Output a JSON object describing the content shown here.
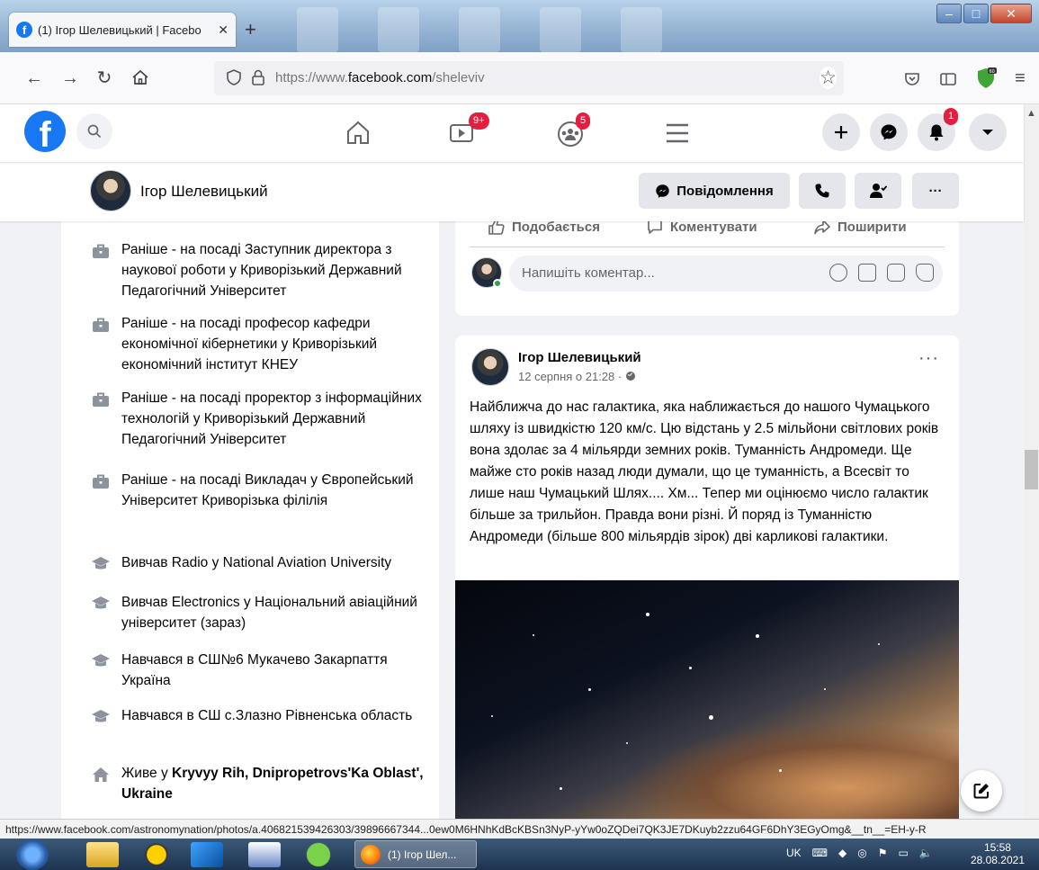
{
  "browser": {
    "tab_title": "(1) Ігор Шелевицький | Facebo",
    "tab_close": "✕",
    "new_tab": "+",
    "url_prefix": "https://www.",
    "url_domain": "facebook.com",
    "url_path": "/sheleviv"
  },
  "fb_nav": {
    "watch_badge": "9+",
    "groups_badge": "5",
    "notifications_badge": "1"
  },
  "profile": {
    "name": "Ігор Шелевицький",
    "message_button": "Повідомлення",
    "more_label": "···"
  },
  "intro": {
    "items": [
      {
        "icon": "briefcase-icon",
        "text": "Раніше - на посаді Заступник директора з наукової роботи у Криворізький Державний Педагогічний Університет"
      },
      {
        "icon": "briefcase-icon",
        "text": "Раніше - на посаді професор кафедри економічної кібернетики у Криворізький економічний інститут КНЕУ"
      },
      {
        "icon": "briefcase-icon",
        "text": "Раніше - на посаді проректор з інформаційних технологій у Криворізький Державний Педагогічний Університет"
      },
      {
        "icon": "briefcase-icon",
        "text": "Раніше - на посаді Викладач у Європейський Університет Криворізька філілія"
      },
      {
        "icon": "graduation-cap-icon",
        "text": "Вивчав Radio у National Aviation University"
      },
      {
        "icon": "graduation-cap-icon",
        "text": "Вивчав Electronics у Національний авіаційний університет (зараз)"
      },
      {
        "icon": "graduation-cap-icon",
        "text": "Навчався в СШ№6 Мукачево Закарпаття Україна"
      },
      {
        "icon": "graduation-cap-icon",
        "text": "Навчався в СШ с.Злазно Рівненська область"
      }
    ],
    "lives_prefix": "Живе у ",
    "lives_place": "Kryvyy Rih, Dnipropetrovs'Ka Oblast', Ukraine"
  },
  "post_actions": {
    "like": "Подобається",
    "comment": "Коментувати",
    "share": "Поширити",
    "comment_placeholder": "Напишіть коментар..."
  },
  "post": {
    "author": "Ігор Шелевицький",
    "date": "12 серпня о 21:28 ·",
    "more": "···",
    "text": "Найближча до нас галактика, яка наближається до нашого Чумацького шляху із швидкістю 120 км/с. Цю відстань у 2.5 мільйони світлових років вона здолає за 4 мільярди земних років. Туманність Андромеди. Ще майже сто років назад люди думали, що це туманність, а Всесвіт то лише наш Чумацький Шлях.... Хм... Тепер ми оцінюємо число галактик більше за трильйон. Правда вони різні. Й поряд із Туманністю Андромеди (більше 800 мільярдів зірок) дві карликові галактики."
  },
  "status_bar": {
    "link": "https://www.facebook.com/astronomynation/photos/a.406821539426303/39896667344...0ew0M6HNhKdBcKBSn3NyP-yYw0oZQDei7QK3JE7DKuyb2zzu64GF6DhY3EGyOmg&__tn__=EH-y-R"
  },
  "taskbar": {
    "firefox_label": "(1) Ігор Шел...",
    "lang": "UK",
    "time": "15:58",
    "date": "28.08.2021"
  },
  "colors": {
    "fb_blue": "#1877f2",
    "badge_red": "#e41e3f",
    "secondary_text": "#65676b"
  }
}
